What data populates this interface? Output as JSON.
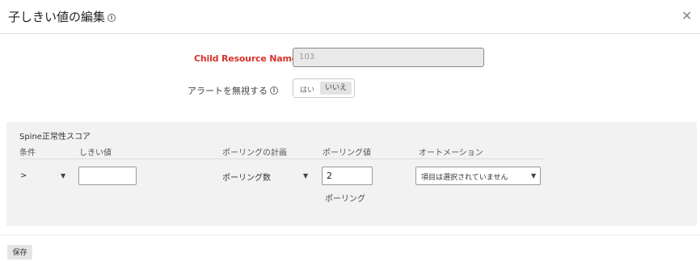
{
  "dialog": {
    "title": "子しきい値の編集",
    "info_glyph": "i",
    "close_glyph": "✕"
  },
  "form": {
    "child_resource_label": "Child Resource Name",
    "child_resource_value": "103",
    "alert_label": "アラートを無視する",
    "alert_toggle": {
      "yes": "はい",
      "no": "いいえ",
      "selected": "いいえ"
    }
  },
  "panel": {
    "title": "Spine正常性スコア",
    "columns": [
      "条件",
      "しきい値",
      "ポーリングの計画",
      "ポーリング値",
      "オートメーション"
    ],
    "row": {
      "condition": ">",
      "threshold": "",
      "polling_plan": "ポーリング数",
      "polling_value": "2",
      "polling_unit": "ポーリング",
      "automation": "項目は選択されていません"
    }
  },
  "footer": {
    "save_label": "保存"
  },
  "colors": {
    "accent_red": "#d6332b",
    "panel_bg": "#f2f2f2"
  }
}
